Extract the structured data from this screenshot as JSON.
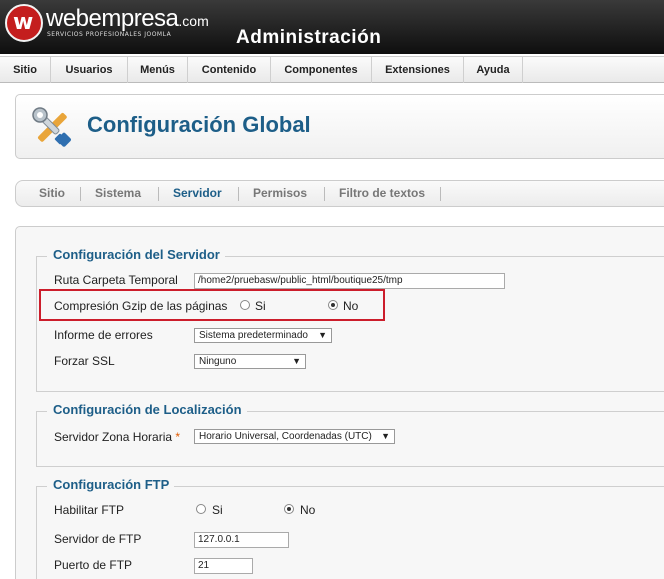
{
  "header": {
    "logo_mark": "w",
    "logo_word": "webempresa",
    "logo_tld": ".com",
    "logo_tagline": "SERVICIOS PROFESIONALES JOOMLA",
    "admin_title": "Administración"
  },
  "menu": [
    "Sitio",
    "Usuarios",
    "Menús",
    "Contenido",
    "Componentes",
    "Extensiones",
    "Ayuda"
  ],
  "toolbar": {
    "icon": "tools-icon",
    "title": "Configuración Global"
  },
  "subtabs": [
    "Sitio",
    "Sistema",
    "Servidor",
    "Permisos",
    "Filtro de textos"
  ],
  "active_subtab": "Servidor",
  "server": {
    "legend": "Configuración del Servidor",
    "temp_path_label": "Ruta Carpeta Temporal",
    "temp_path_value": "/home2/pruebasw/public_html/boutique25/tmp",
    "gzip_label": "Compresión Gzip de las páginas",
    "gzip_yes": "Si",
    "gzip_no": "No",
    "gzip_selected": "No",
    "errors_label": "Informe de errores",
    "errors_value": "Sistema predeterminado",
    "ssl_label": "Forzar SSL",
    "ssl_value": "Ninguno"
  },
  "locale": {
    "legend": "Configuración de Localización",
    "timezone_label": "Servidor Zona Horaria",
    "timezone_required": "*",
    "timezone_value": "Horario Universal, Coordenadas (UTC)"
  },
  "ftp": {
    "legend": "Configuración FTP",
    "enable_label": "Habilitar FTP",
    "enable_yes": "Si",
    "enable_no": "No",
    "enable_selected": "No",
    "server_label": "Servidor de FTP",
    "server_value": "127.0.0.1",
    "port_label": "Puerto de FTP",
    "port_value": "21"
  },
  "colors": {
    "accent": "#1d5e88",
    "highlight": "#cc1d2b",
    "brand_red": "#c41e1e",
    "required": "#e05a00"
  }
}
